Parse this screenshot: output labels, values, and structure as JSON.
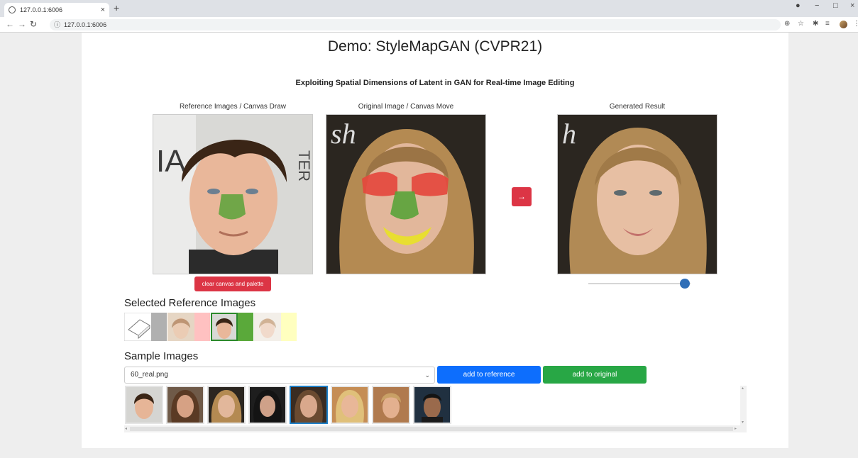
{
  "browser": {
    "tab_title": "127.0.0.1:6006",
    "url": "127.0.0.1:6006"
  },
  "page": {
    "title": "Demo: StyleMapGAN (CVPR21)",
    "subtitle": "Exploiting Spatial Dimensions of Latent in GAN for Real-time Image Editing",
    "panels": {
      "reference_label": "Reference Images / Canvas Draw",
      "original_label": "Original Image / Canvas Move",
      "result_label": "Generated Result"
    },
    "arrow_label": "→",
    "clear_button": "clear canvas and palette",
    "slider_level": 0.9,
    "selected_heading": "Selected Reference Images",
    "sample_heading": "Sample Images",
    "select_value": "60_real.png",
    "add_reference": "add to reference",
    "add_original": "add to original",
    "colors": {
      "danger": "#dc3545",
      "primary": "#0d6efd",
      "success": "#28a745",
      "slider_knob": "#2f6eb7",
      "mask_green": "#5aa33a",
      "mask_red": "#e4463c",
      "mask_yellow": "#e8df2b"
    },
    "reference_palette_colors": [
      "#b0b0b0",
      "#ffc1c1",
      "#5aa93a",
      "#ffffbf"
    ],
    "sample_count": 8,
    "selected_sample_index": 4
  }
}
